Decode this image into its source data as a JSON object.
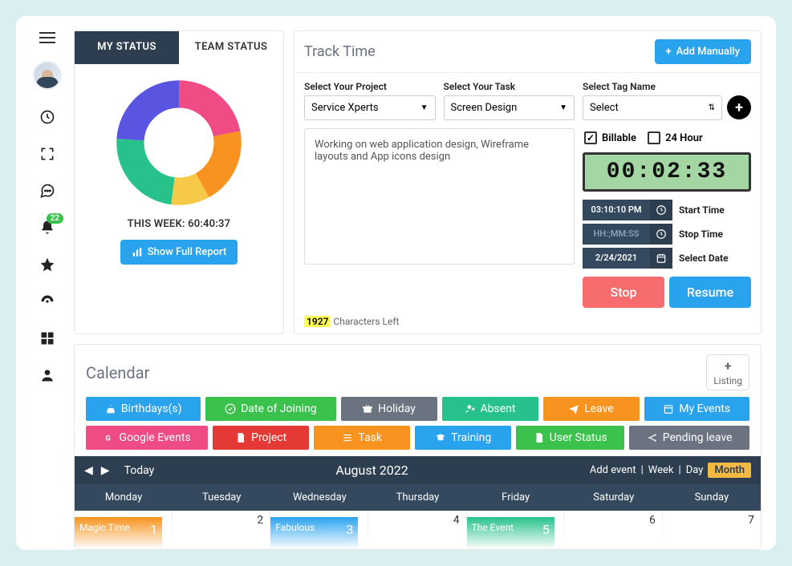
{
  "sidebar": {
    "badge_count": "22"
  },
  "status": {
    "tabs": {
      "my": "MY STATUS",
      "team": "TEAM STATUS"
    },
    "this_week_prefix": "THIS WEEK: ",
    "this_week_time": "60:40:37",
    "report_btn": "Show Full Report"
  },
  "chart_data": {
    "type": "pie",
    "title": "THIS WEEK: 60:40:37",
    "series": [
      {
        "name": "segment-1",
        "value": 22,
        "color": "#ef4b85"
      },
      {
        "name": "segment-2",
        "value": 20,
        "color": "#f7931e"
      },
      {
        "name": "segment-3",
        "value": 10,
        "color": "#f7c948"
      },
      {
        "name": "segment-4",
        "value": 24,
        "color": "#27c28b"
      },
      {
        "name": "segment-5",
        "value": 24,
        "color": "#5a55e0"
      }
    ]
  },
  "track": {
    "title": "Track Time",
    "add_btn": "Add Manually",
    "project_label": "Select Your Project",
    "project_value": "Service Xperts",
    "task_label": "Select Your Task",
    "task_value": "Screen Design",
    "tag_label": "Select Tag Name",
    "tag_value": "Select",
    "description": "Working on web application design, Wireframe layouts and App icons design",
    "chars_num": "1927",
    "chars_suffix": " Characters Left",
    "billable": "Billable",
    "hour24": "24 Hour",
    "timer": "00:02:33",
    "rows": {
      "start": {
        "val": "03:10:10 PM",
        "lbl": "Start Time"
      },
      "stop": {
        "val": "HH:;MM:SS",
        "lbl": "Stop Time"
      },
      "date": {
        "val": "2/24/2021",
        "lbl": "Select Date"
      }
    },
    "stop_btn": "Stop",
    "resume_btn": "Resume"
  },
  "calendar": {
    "title": "Calendar",
    "listing": "Listing",
    "categories": [
      {
        "label": "Birthdays(s)",
        "color": "#2aa3ef",
        "icon": "cake"
      },
      {
        "label": "Date of Joining",
        "color": "#3bc24c",
        "icon": "check"
      },
      {
        "label": "Holiday",
        "color": "#6b7280",
        "icon": "gift"
      },
      {
        "label": "Absent",
        "color": "#27c28b",
        "icon": "userx"
      },
      {
        "label": "Leave",
        "color": "#f7931e",
        "icon": "plane"
      },
      {
        "label": "My Events",
        "color": "#2aa3ef",
        "icon": "cal"
      },
      {
        "label": "Google Events",
        "color": "#ef4b85",
        "icon": "g"
      },
      {
        "label": "Project",
        "color": "#e53935",
        "icon": "file"
      },
      {
        "label": "Task",
        "color": "#f7931e",
        "icon": "list"
      },
      {
        "label": "Training",
        "color": "#2aa3ef",
        "icon": "grad"
      },
      {
        "label": "User Status",
        "color": "#3bc24c",
        "icon": "file"
      },
      {
        "label": "Pending leave",
        "color": "#6b7280",
        "icon": "share"
      }
    ],
    "today": "Today",
    "month_label": "August 2022",
    "add_event": "Add event",
    "views": {
      "week": "Week",
      "day": "Day",
      "month": "Month"
    },
    "dow": [
      "Monday",
      "Tuesday",
      "Wednesday",
      "Thursday",
      "Friday",
      "Saturday",
      "Sunday"
    ],
    "row1": {
      "cells": [
        {
          "day": "1",
          "event": "Magic Time",
          "color": "#f7931e"
        },
        {
          "day": "2"
        },
        {
          "day": "3",
          "event": "Fabulous",
          "color": "#2aa3ef"
        },
        {
          "day": "4"
        },
        {
          "day": "5",
          "event": "The Event",
          "color": "#27c28b"
        },
        {
          "day": "6"
        },
        {
          "day": "7"
        }
      ]
    }
  }
}
